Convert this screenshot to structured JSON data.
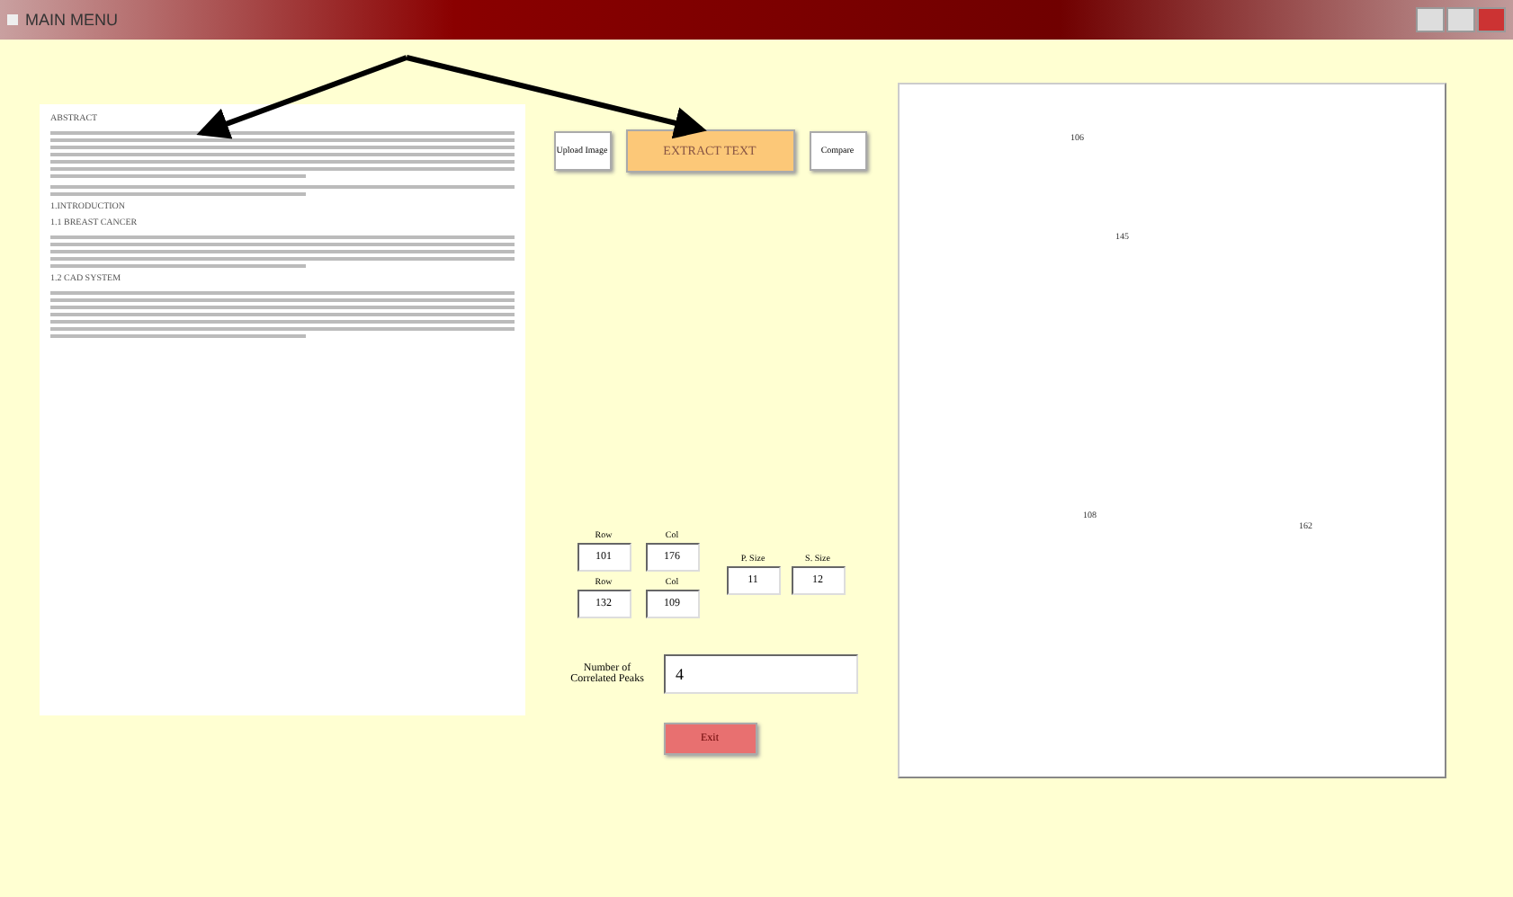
{
  "window": {
    "title": "MAIN MENU"
  },
  "document": {
    "sections": [
      {
        "kind": "heading",
        "text": "ABSTRACT"
      },
      {
        "kind": "text-block"
      },
      {
        "kind": "text-block"
      },
      {
        "kind": "heading",
        "text": "1.INTRODUCTION"
      },
      {
        "kind": "heading",
        "text": "1.1 BREAST CANCER"
      },
      {
        "kind": "text-block"
      },
      {
        "kind": "heading",
        "text": "1.2 CAD SYSTEM"
      },
      {
        "kind": "text-block"
      }
    ]
  },
  "buttons": [
    {
      "label": "Upload Image",
      "kind": "small"
    },
    {
      "label": "EXTRACT TEXT",
      "kind": "primary"
    },
    {
      "label": "Compare",
      "kind": "small"
    }
  ],
  "coordinates": [
    {
      "label": "Row",
      "value": "101"
    },
    {
      "label": "Col",
      "value": "176"
    },
    {
      "label": "Row",
      "value": "132"
    },
    {
      "label": "Col",
      "value": "109"
    }
  ],
  "sizes": [
    {
      "label": "P. Size",
      "value": "11"
    },
    {
      "label": "S. Size",
      "value": "12"
    }
  ],
  "correlated_peaks": {
    "label": "Number of Correlated Peaks",
    "value": "4"
  },
  "exit_button": {
    "label": "Exit"
  },
  "image_panel": {
    "labels": [
      "106",
      "145",
      "108",
      "162"
    ]
  }
}
